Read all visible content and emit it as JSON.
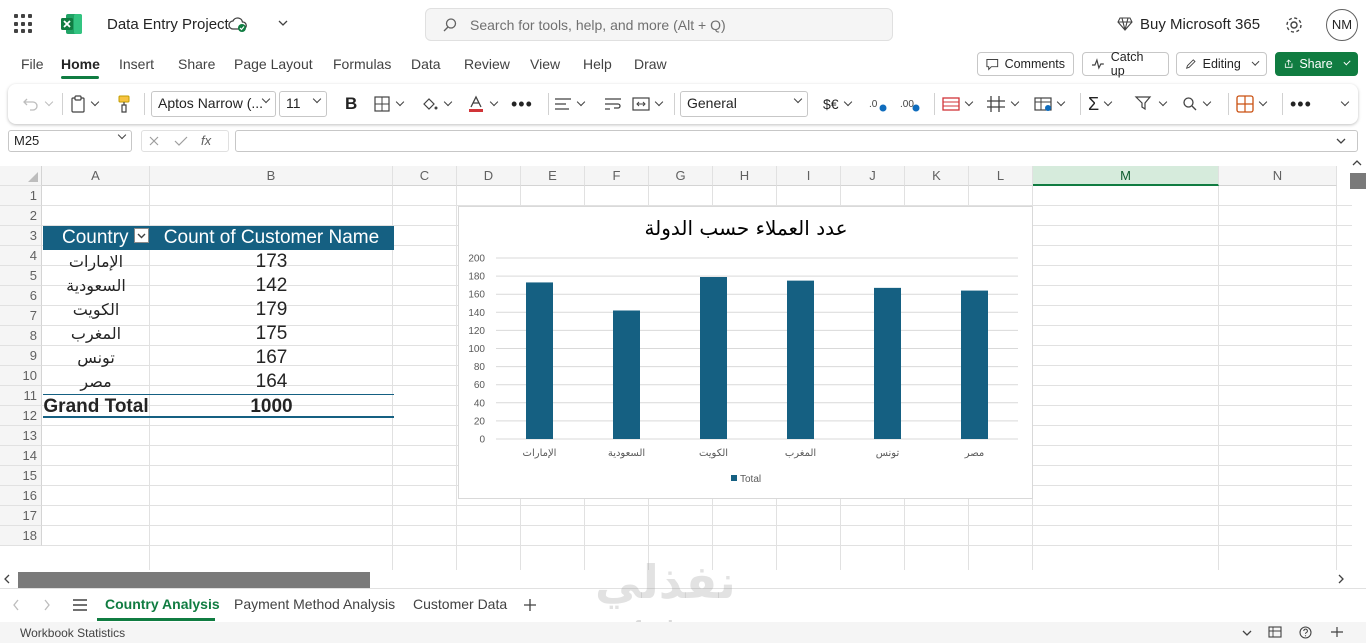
{
  "app": {
    "doc_title": "Data Entry Project",
    "search_placeholder": "Search for tools, help, and more (Alt + Q)",
    "buy_label": "Buy Microsoft 365",
    "avatar_initials": "NM"
  },
  "menu": {
    "tabs": [
      "File",
      "Home",
      "Insert",
      "Share",
      "Page Layout",
      "Formulas",
      "Data",
      "Review",
      "View",
      "Help",
      "Draw"
    ],
    "active_tab": "Home",
    "comments_label": "Comments",
    "catchup_label": "Catch up",
    "editing_label": "Editing",
    "share_label": "Share"
  },
  "ribbon": {
    "font_name": "Aptos Narrow (...",
    "font_size": "11",
    "number_format": "General",
    "currency_label": "$€"
  },
  "formula_bar": {
    "name_box": "M25",
    "fx_label": "fx",
    "formula": ""
  },
  "grid": {
    "columns": [
      "A",
      "B",
      "C",
      "D",
      "E",
      "F",
      "G",
      "H",
      "I",
      "J",
      "K",
      "L",
      "M",
      "N"
    ],
    "selected_column": "M",
    "rows": [
      "1",
      "2",
      "3",
      "4",
      "5",
      "6",
      "7",
      "8",
      "9",
      "10",
      "11",
      "12",
      "13",
      "14",
      "15",
      "16",
      "17",
      "18"
    ]
  },
  "pivot": {
    "header_country": "Country",
    "header_count": "Count of Customer Name",
    "rows": [
      {
        "country": "الإمارات",
        "count": "173"
      },
      {
        "country": "السعودية",
        "count": "142"
      },
      {
        "country": "الكويت",
        "count": "179"
      },
      {
        "country": "المغرب",
        "count": "175"
      },
      {
        "country": "تونس",
        "count": "167"
      },
      {
        "country": "مصر",
        "count": "164"
      }
    ],
    "total_label": "Grand Total",
    "total_value": "1000"
  },
  "chart_data": {
    "type": "bar",
    "title": "عدد العملاء حسب الدولة",
    "categories": [
      "الإمارات",
      "السعودية",
      "الكويت",
      "المغرب",
      "تونس",
      "مصر"
    ],
    "series": [
      {
        "name": "Total",
        "values": [
          173,
          142,
          179,
          175,
          167,
          164
        ]
      }
    ],
    "ylim": [
      0,
      200
    ],
    "yticks": [
      0,
      20,
      40,
      60,
      80,
      100,
      120,
      140,
      160,
      180,
      200
    ],
    "grid": true,
    "legend": "bottom",
    "color": "#156082"
  },
  "sheets": {
    "tabs": [
      "Country Analysis",
      "Payment Method Analysis",
      "Customer Data"
    ],
    "active": "Country Analysis"
  },
  "status": {
    "left": "Workbook Statistics"
  },
  "watermark": {
    "text": "نفذلي",
    "sub": "nafezly.com"
  }
}
